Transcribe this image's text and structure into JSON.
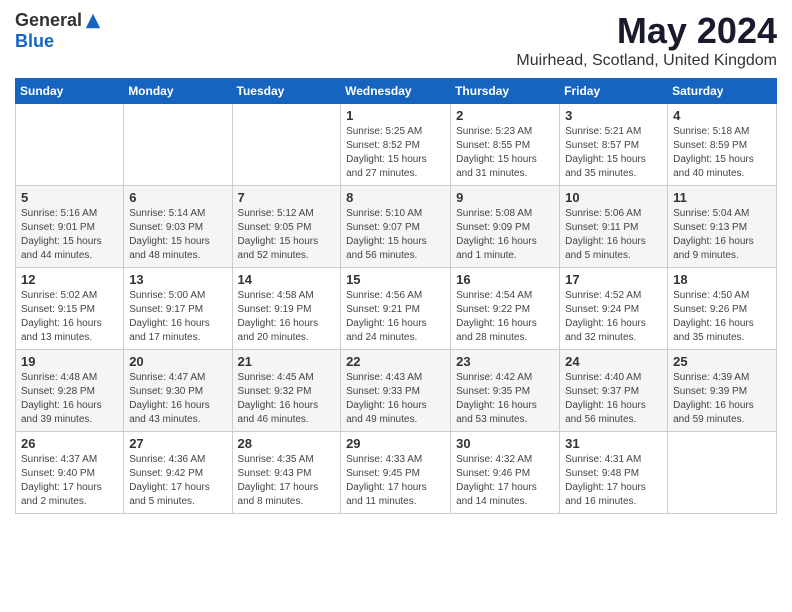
{
  "header": {
    "logo": {
      "general": "General",
      "blue": "Blue"
    },
    "title": "May 2024",
    "location": "Muirhead, Scotland, United Kingdom"
  },
  "calendar": {
    "days_of_week": [
      "Sunday",
      "Monday",
      "Tuesday",
      "Wednesday",
      "Thursday",
      "Friday",
      "Saturday"
    ],
    "weeks": [
      [
        {
          "day": "",
          "info": ""
        },
        {
          "day": "",
          "info": ""
        },
        {
          "day": "",
          "info": ""
        },
        {
          "day": "1",
          "info": "Sunrise: 5:25 AM\nSunset: 8:52 PM\nDaylight: 15 hours and 27 minutes."
        },
        {
          "day": "2",
          "info": "Sunrise: 5:23 AM\nSunset: 8:55 PM\nDaylight: 15 hours and 31 minutes."
        },
        {
          "day": "3",
          "info": "Sunrise: 5:21 AM\nSunset: 8:57 PM\nDaylight: 15 hours and 35 minutes."
        },
        {
          "day": "4",
          "info": "Sunrise: 5:18 AM\nSunset: 8:59 PM\nDaylight: 15 hours and 40 minutes."
        }
      ],
      [
        {
          "day": "5",
          "info": "Sunrise: 5:16 AM\nSunset: 9:01 PM\nDaylight: 15 hours and 44 minutes."
        },
        {
          "day": "6",
          "info": "Sunrise: 5:14 AM\nSunset: 9:03 PM\nDaylight: 15 hours and 48 minutes."
        },
        {
          "day": "7",
          "info": "Sunrise: 5:12 AM\nSunset: 9:05 PM\nDaylight: 15 hours and 52 minutes."
        },
        {
          "day": "8",
          "info": "Sunrise: 5:10 AM\nSunset: 9:07 PM\nDaylight: 15 hours and 56 minutes."
        },
        {
          "day": "9",
          "info": "Sunrise: 5:08 AM\nSunset: 9:09 PM\nDaylight: 16 hours and 1 minute."
        },
        {
          "day": "10",
          "info": "Sunrise: 5:06 AM\nSunset: 9:11 PM\nDaylight: 16 hours and 5 minutes."
        },
        {
          "day": "11",
          "info": "Sunrise: 5:04 AM\nSunset: 9:13 PM\nDaylight: 16 hours and 9 minutes."
        }
      ],
      [
        {
          "day": "12",
          "info": "Sunrise: 5:02 AM\nSunset: 9:15 PM\nDaylight: 16 hours and 13 minutes."
        },
        {
          "day": "13",
          "info": "Sunrise: 5:00 AM\nSunset: 9:17 PM\nDaylight: 16 hours and 17 minutes."
        },
        {
          "day": "14",
          "info": "Sunrise: 4:58 AM\nSunset: 9:19 PM\nDaylight: 16 hours and 20 minutes."
        },
        {
          "day": "15",
          "info": "Sunrise: 4:56 AM\nSunset: 9:21 PM\nDaylight: 16 hours and 24 minutes."
        },
        {
          "day": "16",
          "info": "Sunrise: 4:54 AM\nSunset: 9:22 PM\nDaylight: 16 hours and 28 minutes."
        },
        {
          "day": "17",
          "info": "Sunrise: 4:52 AM\nSunset: 9:24 PM\nDaylight: 16 hours and 32 minutes."
        },
        {
          "day": "18",
          "info": "Sunrise: 4:50 AM\nSunset: 9:26 PM\nDaylight: 16 hours and 35 minutes."
        }
      ],
      [
        {
          "day": "19",
          "info": "Sunrise: 4:48 AM\nSunset: 9:28 PM\nDaylight: 16 hours and 39 minutes."
        },
        {
          "day": "20",
          "info": "Sunrise: 4:47 AM\nSunset: 9:30 PM\nDaylight: 16 hours and 43 minutes."
        },
        {
          "day": "21",
          "info": "Sunrise: 4:45 AM\nSunset: 9:32 PM\nDaylight: 16 hours and 46 minutes."
        },
        {
          "day": "22",
          "info": "Sunrise: 4:43 AM\nSunset: 9:33 PM\nDaylight: 16 hours and 49 minutes."
        },
        {
          "day": "23",
          "info": "Sunrise: 4:42 AM\nSunset: 9:35 PM\nDaylight: 16 hours and 53 minutes."
        },
        {
          "day": "24",
          "info": "Sunrise: 4:40 AM\nSunset: 9:37 PM\nDaylight: 16 hours and 56 minutes."
        },
        {
          "day": "25",
          "info": "Sunrise: 4:39 AM\nSunset: 9:39 PM\nDaylight: 16 hours and 59 minutes."
        }
      ],
      [
        {
          "day": "26",
          "info": "Sunrise: 4:37 AM\nSunset: 9:40 PM\nDaylight: 17 hours and 2 minutes."
        },
        {
          "day": "27",
          "info": "Sunrise: 4:36 AM\nSunset: 9:42 PM\nDaylight: 17 hours and 5 minutes."
        },
        {
          "day": "28",
          "info": "Sunrise: 4:35 AM\nSunset: 9:43 PM\nDaylight: 17 hours and 8 minutes."
        },
        {
          "day": "29",
          "info": "Sunrise: 4:33 AM\nSunset: 9:45 PM\nDaylight: 17 hours and 11 minutes."
        },
        {
          "day": "30",
          "info": "Sunrise: 4:32 AM\nSunset: 9:46 PM\nDaylight: 17 hours and 14 minutes."
        },
        {
          "day": "31",
          "info": "Sunrise: 4:31 AM\nSunset: 9:48 PM\nDaylight: 17 hours and 16 minutes."
        },
        {
          "day": "",
          "info": ""
        }
      ]
    ]
  }
}
